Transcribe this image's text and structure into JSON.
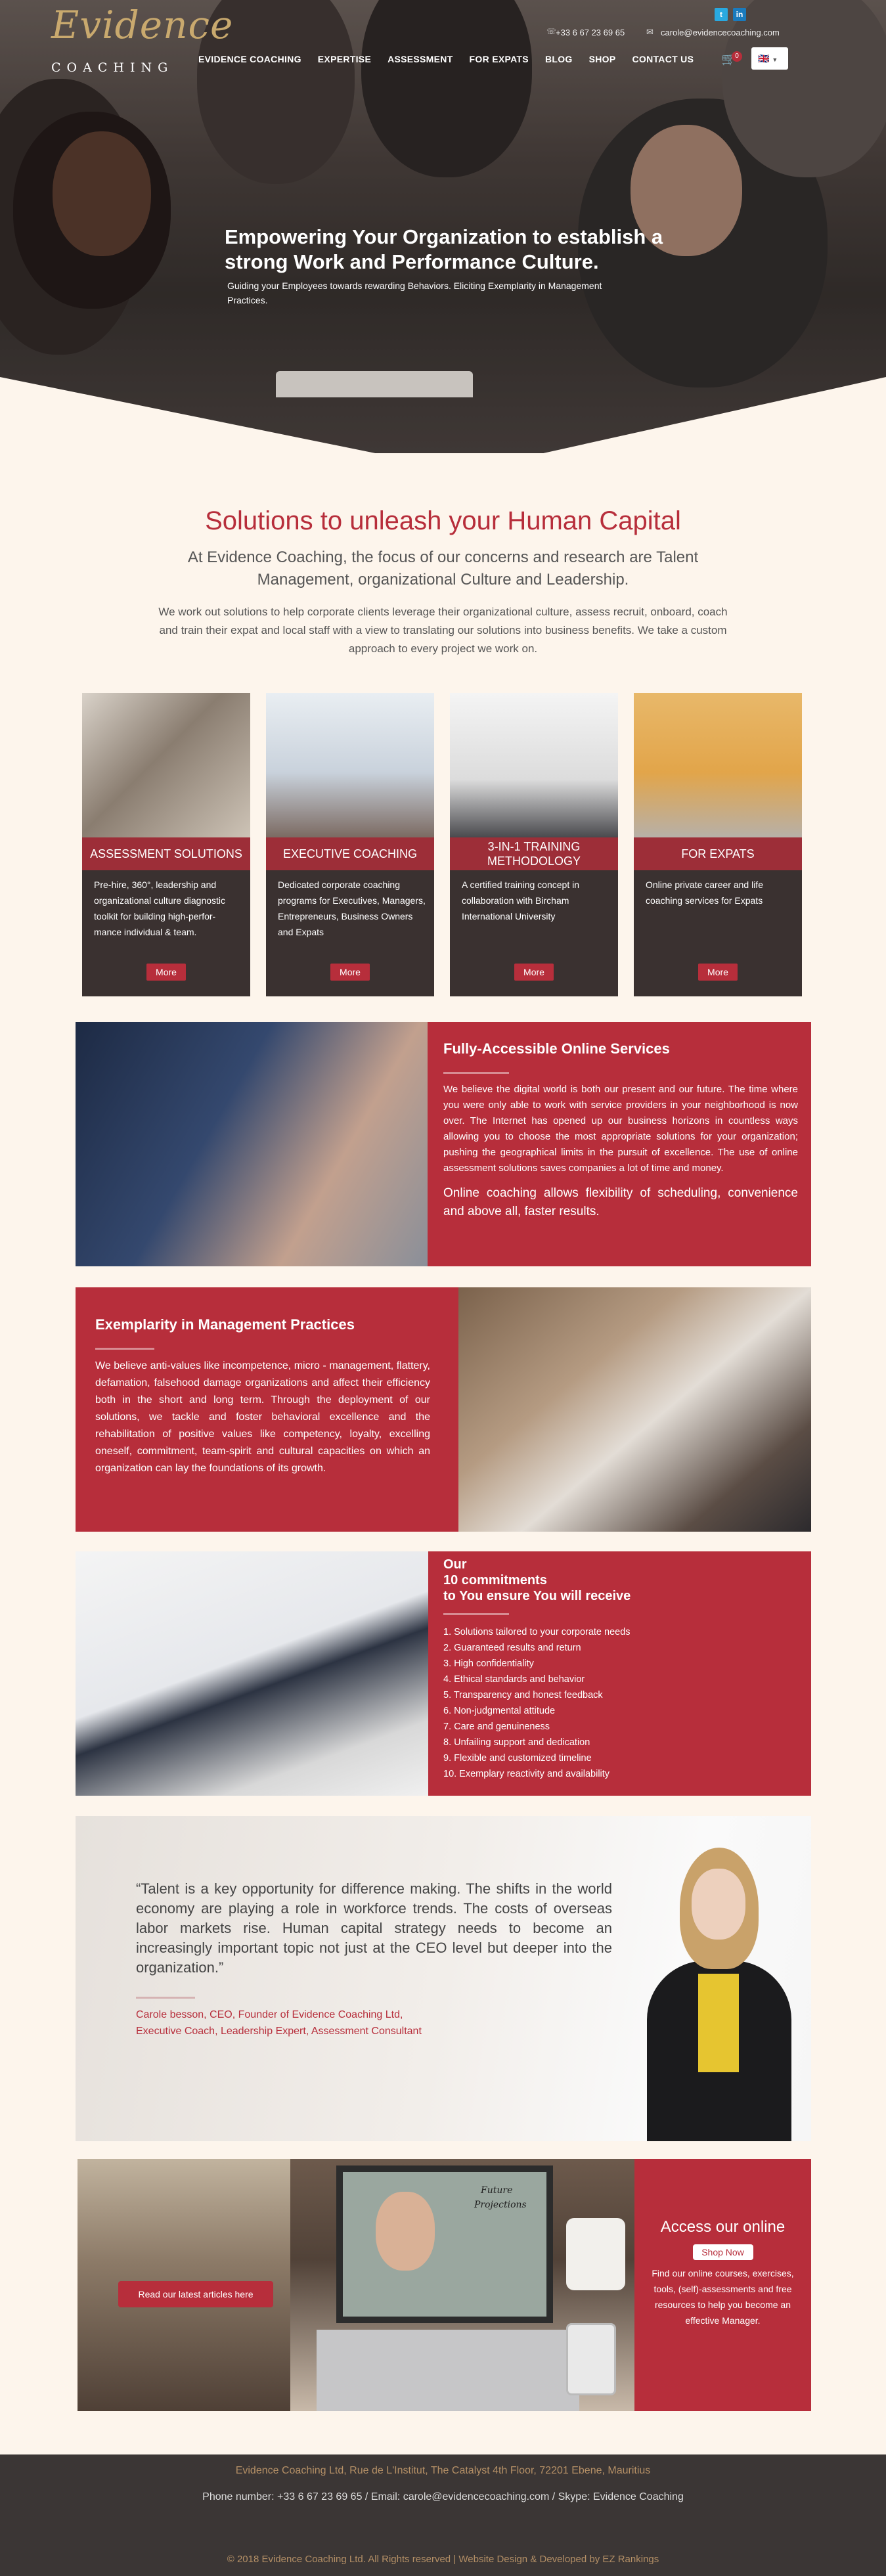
{
  "header": {
    "logo_script": "Evidence",
    "logo_caps": "COACHING",
    "phone": "+33 6 67 23 69 65",
    "email": "carole@evidencecoaching.com",
    "cart_count": "0",
    "language": "🇬🇧",
    "social": [
      "t",
      "in"
    ],
    "nav": [
      "EVIDENCE COACHING",
      "EXPERTISE",
      "ASSESSMENT",
      "FOR EXPATS",
      "BLOG",
      "SHOP",
      "CONTACT US"
    ]
  },
  "hero": {
    "title": "Empowering Your Organization to establish a strong Work and Performance Culture.",
    "subtitle": "Guiding your Employees towards rewarding Behaviors. Eliciting Exemplarity in Management Practices."
  },
  "intro": {
    "title": "Solutions to unleash your Human Capital",
    "subtitle": "At Evidence Coaching, the focus of our concerns and research are Talent Management, organizational Culture and Leadership.",
    "paragraph": "We work out solutions to help corporate clients leverage their organizational culture, assess recruit, onboard, coach and train their expat and local staff with a view to translating our solutions into business benefits. We take a custom approach to every project we work on."
  },
  "cards": [
    {
      "label": "ASSESSMENT SOLUTIONS",
      "text": "Pre-hire, 360°, leadership and organizational culture diagnostic toolkit for building high-perfor-mance individual & team.",
      "button": "More"
    },
    {
      "label": "EXECUTIVE COACHING",
      "text": "Dedicated corporate coaching programs for Executives, Managers, Entrepreneurs, Business Owners and Expats",
      "button": "More"
    },
    {
      "label": "3-IN-1 TRAINING METHODOLOGY",
      "text": "A certified training concept in collaboration with Bircham International University",
      "button": "More"
    },
    {
      "label": "FOR EXPATS",
      "text": "Online private career and life coaching services for Expats",
      "button": "More"
    }
  ],
  "online": {
    "title": "Fully-Accessible Online Services",
    "p1": "We believe the digital world is both our present and our future. The time where you were only able to work with service providers in your neighborhood is now over. The Internet has opened up our business horizons in countless ways allowing you to choose the most appropriate solutions for your organization; pushing the geographical limits in the pursuit of excellence. The use of online assessment solutions saves companies a lot of time and money.",
    "p2": "Online coaching allows flexibility of scheduling, convenience and above all, faster results."
  },
  "exemplarity": {
    "title": "Exemplarity in Management Practices",
    "text": "We believe anti-values like incompetence, micro - management, flattery, defamation, falsehood damage organizations and affect their efficiency both in the short and long term. Through the deployment of our solutions, we tackle and foster behavioral excellence and the rehabilitation of positive values like competency, loyalty, excelling oneself, commitment, team-spirit and cultural capacities on which an organization can lay the foundations of its growth."
  },
  "commitments": {
    "title_lines": [
      "Our",
      "10 commitments",
      "to You ensure You will receive"
    ],
    "items": [
      "1. Solutions tailored to your corporate needs",
      "2. Guaranteed results and return",
      "3. High confidentiality",
      "4. Ethical standards and behavior",
      "5. Transparency and honest feedback",
      "6. Non-judgmental attitude",
      "7. Care and genuineness",
      "8. Unfailing support and dedication",
      "9. Flexible and customized timeline",
      "10. Exemplary reactivity and availability"
    ]
  },
  "quote": {
    "text": "“Talent is a key opportunity for difference making. The shifts in the world economy are playing a role in workforce trends. The costs of overseas labor markets rise. Human capital strategy needs to become an increasingly important topic not just at the CEO level but deeper into the organization.”",
    "author_line1": "Carole besson, CEO, Founder of Evidence Coaching Ltd,",
    "author_line2": "Executive Coach, Leadership Expert, Assessment Consultant"
  },
  "bottom": {
    "articles_button": "Read our latest articles here",
    "board_line1": "Future",
    "board_line2": "Projections",
    "access_title": "Access our online",
    "shop_button": "Shop Now",
    "access_text": "Find our online courses, exercises, tools, (self)-assessments and free resources to help you become an effective Manager."
  },
  "footer": {
    "address": "Evidence Coaching Ltd, Rue de L'Institut, The Catalyst 4th Floor, 72201 Ebene, Mauritius",
    "contact": "Phone number: +33 6 67 23 69 65 / Email: carole@evidencecoaching.com / Skype: Evidence Coaching",
    "copyright": "© 2018 Evidence Coaching Ltd. All Rights reserved | Website Design & Developed by EZ Rankings"
  },
  "colors": {
    "accent": "#b72e3b",
    "cream": "#fdf5ec",
    "dark": "#3a3130",
    "gold": "#c9a96e"
  }
}
